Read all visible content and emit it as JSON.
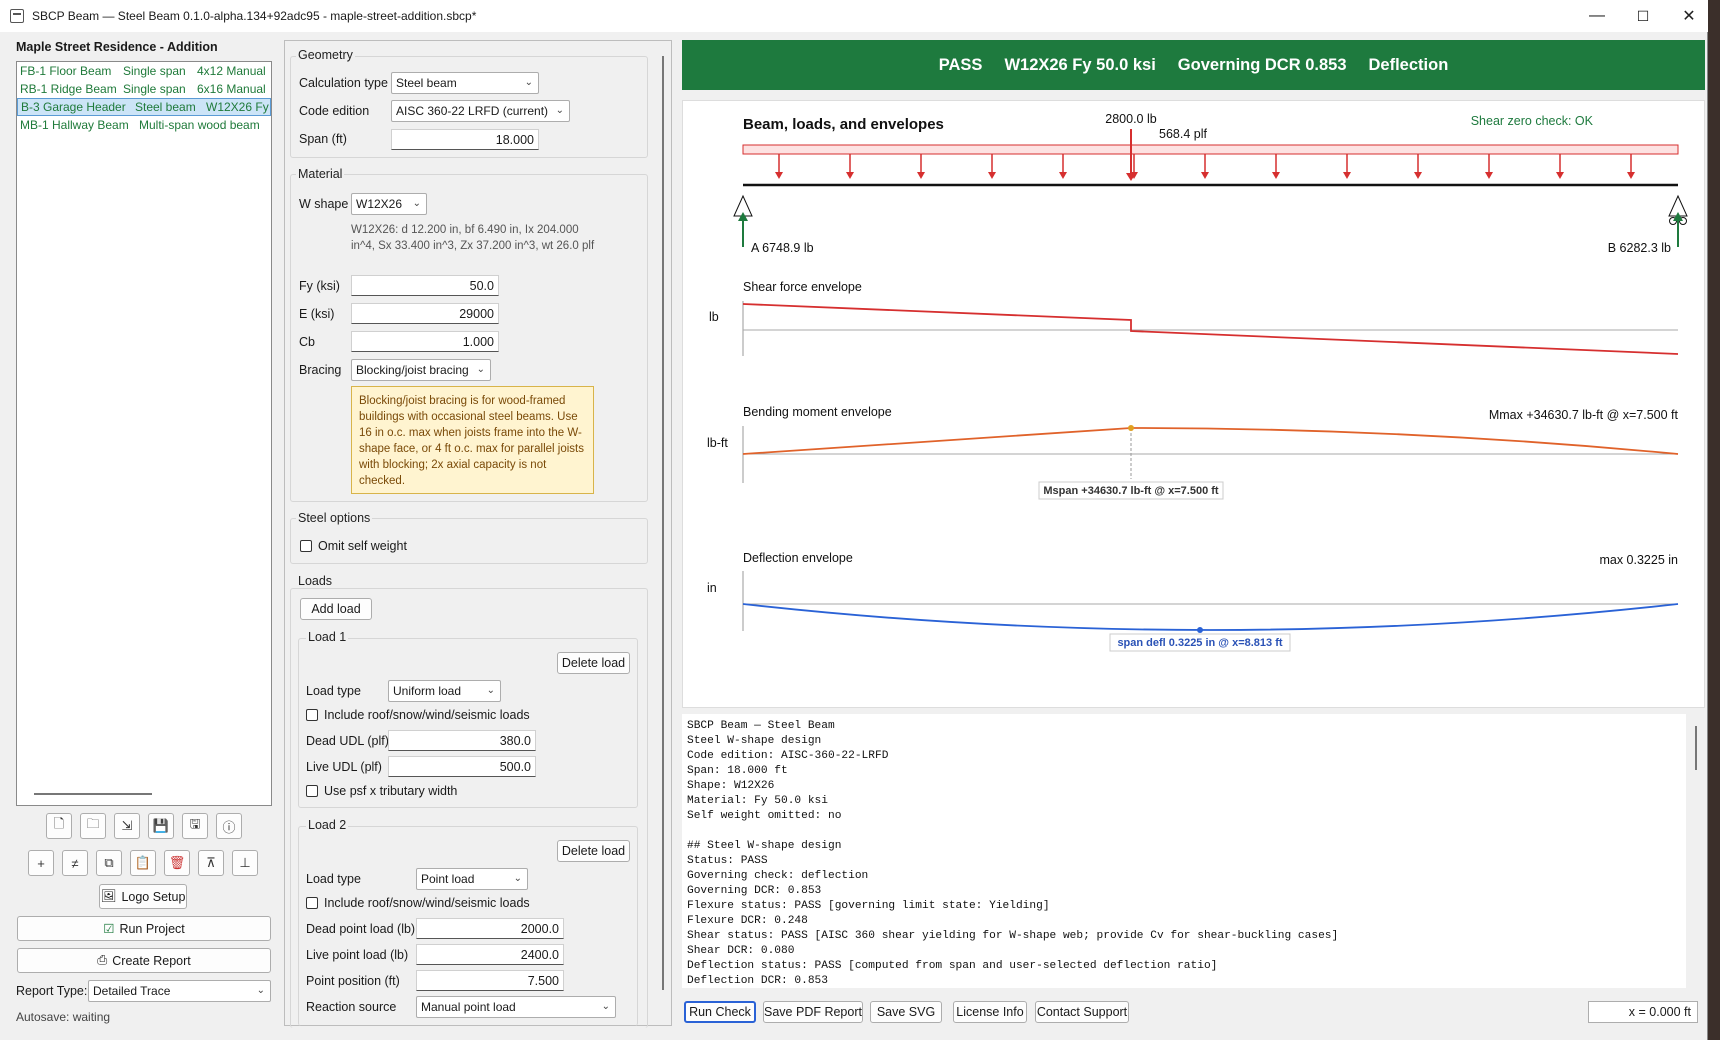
{
  "window": {
    "title": "SBCP Beam — Steel Beam 0.1.0-alpha.134+92adc95 - maple-street-addition.sbcp*",
    "minimize": "—",
    "maximize": "☐",
    "close": "✕"
  },
  "project": {
    "title": "Maple Street Residence - Addition",
    "beams": [
      {
        "name": "FB-1 Floor Beam",
        "type": "Single span",
        "detail": "4x12 Manual"
      },
      {
        "name": "RB-1 Ridge Beam",
        "type": "Single span",
        "detail": "6x16 Manual"
      },
      {
        "name": "B-3 Garage Header",
        "type": "Steel beam",
        "detail": "W12X26 Fy"
      },
      {
        "name": "MB-1 Hallway Beam",
        "type": "Multi-span wood beam",
        "detail": ""
      }
    ],
    "selected_index": 2
  },
  "left_actions": {
    "logo_setup": "Logo Setup",
    "run_project": "Run Project",
    "create_report": "Create Report",
    "report_type_label": "Report Type:",
    "report_type_value": "Detailed Trace",
    "autosave": "Autosave: waiting"
  },
  "geometry": {
    "group_title": "Geometry",
    "calc_type_label": "Calculation type",
    "calc_type_value": "Steel beam",
    "code_edition_label": "Code edition",
    "code_edition_value": "AISC 360-22 LRFD (current)",
    "span_label": "Span (ft)",
    "span_value": "18.000"
  },
  "material": {
    "group_title": "Material",
    "wshape_label": "W shape",
    "wshape_value": "W12X26",
    "shape_info": "W12X26: d 12.200 in, bf 6.490 in, Ix 204.000 in^4, Sx 33.400 in^3, Zx 37.200 in^3, wt 26.0 plf",
    "fy_label": "Fy (ksi)",
    "fy_value": "50.0",
    "e_label": "E (ksi)",
    "e_value": "29000",
    "cb_label": "Cb",
    "cb_value": "1.000",
    "bracing_label": "Bracing",
    "bracing_value": "Blocking/joist bracing",
    "note": "Blocking/joist bracing is for wood-framed buildings with occasional steel beams. Use 16 in o.c. max when joists frame into the W-shape face, or 4 ft o.c. max for parallel joists with blocking; 2x axial capacity is not checked."
  },
  "steel_options": {
    "group_title": "Steel options",
    "omit_self_weight": "Omit self weight"
  },
  "loads": {
    "group_title": "Loads",
    "add_load": "Add load",
    "load1": {
      "title": "Load 1",
      "delete": "Delete load",
      "type_label": "Load type",
      "type_value": "Uniform load",
      "include_env": "Include roof/snow/wind/seismic loads",
      "dead_label": "Dead UDL (plf)",
      "dead_value": "380.0",
      "live_label": "Live UDL (plf)",
      "live_value": "500.0",
      "use_psf": "Use psf x tributary width"
    },
    "load2": {
      "title": "Load 2",
      "delete": "Delete load",
      "type_label": "Load type",
      "type_value": "Point load",
      "include_env": "Include roof/snow/wind/seismic loads",
      "dead_label": "Dead point load (lb)",
      "dead_value": "2000.0",
      "live_label": "Live point load (lb)",
      "live_value": "2400.0",
      "pos_label": "Point position (ft)",
      "pos_value": "7.500",
      "reaction_label": "Reaction source",
      "reaction_value": "Manual point load"
    }
  },
  "status": {
    "result": "PASS",
    "section": "W12X26 Fy 50.0 ksi",
    "dcr": "Governing DCR 0.853",
    "governing": "Deflection",
    "color": "#1e7a3e"
  },
  "diagram": {
    "title": "Beam, loads, and envelopes",
    "shear_check": "Shear zero check: OK",
    "point_load_label": "2800.0 lb",
    "udl_label": "568.4 plf",
    "reaction_a": "A 6748.9 lb",
    "reaction_b": "B 6282.3 lb",
    "shear_title": "Shear force envelope",
    "shear_unit": "lb",
    "moment_title": "Bending moment envelope",
    "moment_unit": "lb-ft",
    "moment_max": "Mmax +34630.7 lb-ft @ x=7.500 ft",
    "moment_span_label": "Mspan +34630.7 lb-ft @ x=7.500 ft",
    "defl_title": "Deflection envelope",
    "defl_unit": "in",
    "defl_max": "max 0.3225 in",
    "defl_span_label": "span defl 0.3225 in @ x=8.813 ft",
    "colors": {
      "shear": "#d62f2f",
      "moment": "#e0622a",
      "deflection": "#2a62d6",
      "load": "#d62f2f",
      "reaction": "#1e7a3e"
    }
  },
  "report_lines": [
    "SBCP Beam — Steel Beam",
    "Steel W-shape design",
    "Code edition: AISC-360-22-LRFD",
    "Span: 18.000 ft",
    "Shape: W12X26",
    "Material: Fy 50.0 ksi",
    "Self weight omitted: no",
    "",
    "## Steel W-shape design",
    "Status: PASS",
    "Governing check: deflection",
    "Governing DCR: 0.853",
    "Flexure status: PASS [governing limit state: Yielding]",
    "Flexure DCR: 0.248",
    "Shear status: PASS [AISC 360 shear yielding for W-shape web; provide Cv for shear-buckling cases]",
    "Shear DCR: 0.080",
    "Deflection status: PASS [computed from span and user-selected deflection ratio]",
    "Deflection DCR: 0.853"
  ],
  "bottom": {
    "run_check": "Run Check",
    "save_pdf": "Save PDF Report",
    "save_svg": "Save SVG",
    "license": "License Info",
    "support": "Contact Support",
    "x_readout": "x = 0.000 ft"
  }
}
